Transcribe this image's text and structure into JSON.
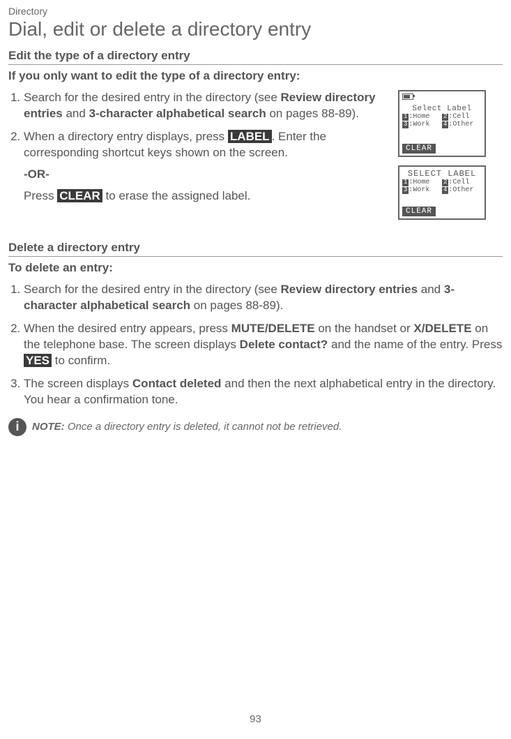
{
  "breadcrumb": "Directory",
  "page_title": "Dial, edit or delete a directory entry",
  "edit_section": {
    "heading": "Edit the type of a directory entry",
    "subheading": "If you only want to edit the type of a directory entry:",
    "step1_a": "Search for the desired entry in the directory (see ",
    "step1_b": "Review directory entries",
    "step1_c": " and ",
    "step1_d": "3-character alphabetical search",
    "step1_e": " on pages 88-89).",
    "step2_a": "When a directory entry displays, press ",
    "step2_label": "LABEL",
    "step2_b": ". Enter the corresponding shortcut keys shown on the screen.",
    "or": "-OR-",
    "alt_a": "Press ",
    "alt_clear": "CLEAR",
    "alt_b": " to erase the assigned label."
  },
  "delete_section": {
    "heading": "Delete a directory entry",
    "subheading": "To delete an entry:",
    "step1_a": "Search for the desired entry in the directory (see ",
    "step1_b": "Review directory entries",
    "step1_c": " and ",
    "step1_d": "3-character alphabetical search",
    "step1_e": " on pages 88-89).",
    "step2_a": "When the desired entry appears, press ",
    "step2_b": "MUTE/DELETE",
    "step2_c": " on the handset or ",
    "step2_d": "X/DELETE",
    "step2_e": " on the telephone base. The screen displays ",
    "step2_f": "Delete contact?",
    "step2_g": " and the name of the entry. Press ",
    "step2_yes": "YES",
    "step2_h": " to confirm.",
    "step3_a": "The screen displays ",
    "step3_b": "Contact deleted",
    "step3_c": " and then the next alphabetical entry in the directory. You hear a confirmation tone."
  },
  "note": {
    "label": "NOTE:",
    "text": " Once a directory entry is deleted, it cannot not be retrieved."
  },
  "screens": {
    "s1": {
      "title": "Select Label",
      "opts": [
        {
          "n": "1",
          "t": ":Home"
        },
        {
          "n": "2",
          "t": ":Cell"
        },
        {
          "n": "3",
          "t": ":Work"
        },
        {
          "n": "4",
          "t": ":Other"
        }
      ],
      "soft": "CLEAR"
    },
    "s2": {
      "title": "SELECT LABEL",
      "opts": [
        {
          "n": "1",
          "t": ":Home"
        },
        {
          "n": "2",
          "t": ":Cell"
        },
        {
          "n": "3",
          "t": ":Work"
        },
        {
          "n": "4",
          "t": ":Other"
        }
      ],
      "soft": "CLEAR"
    }
  },
  "page_number": "93"
}
